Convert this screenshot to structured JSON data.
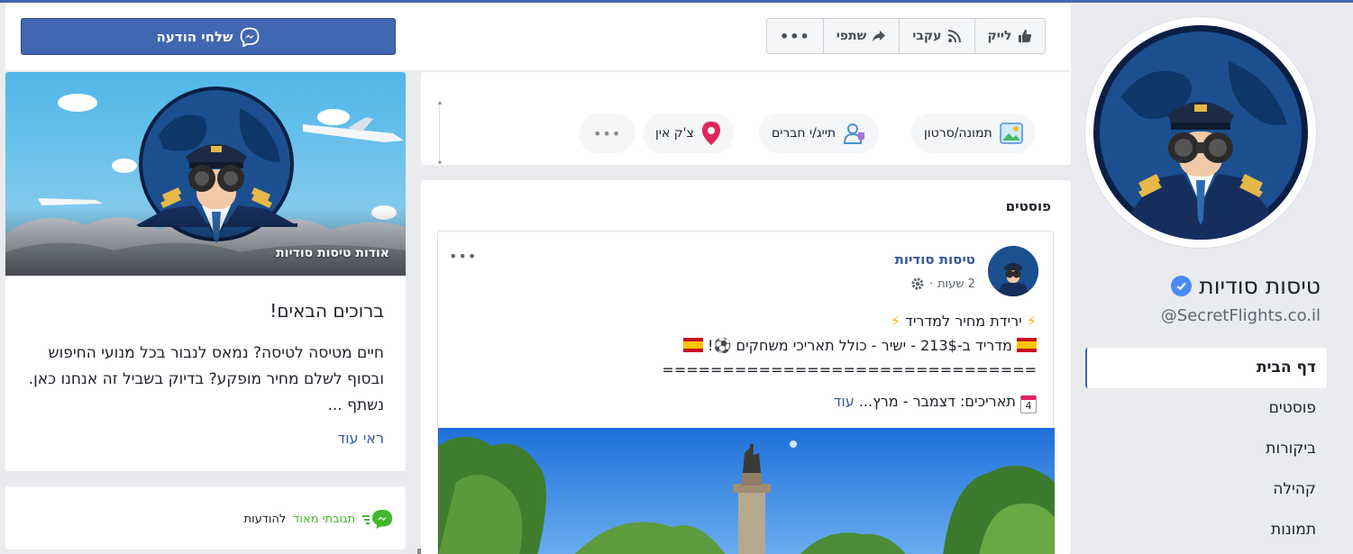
{
  "page": {
    "name": "טיסות סודיות",
    "handle": "@SecretFlights.co.il"
  },
  "nav": {
    "items": [
      {
        "label": "דף הבית"
      },
      {
        "label": "פוסטים"
      },
      {
        "label": "ביקורות"
      },
      {
        "label": "קהילה"
      },
      {
        "label": "תמונות"
      }
    ]
  },
  "actions": {
    "like": "לייק",
    "follow": "עקבי",
    "share": "שתפי",
    "more": "•••"
  },
  "composer": {
    "photo_video": "תמונה/סרטון",
    "tag_friends": "תייג/י חברים",
    "check_in": "צ'ק אין",
    "more": "•••"
  },
  "posts": {
    "title": "פוסטים",
    "post": {
      "author": "טיסות סודיות",
      "time": "2 שעות",
      "sep": "·",
      "line1": "ירידת מחיר למדריד",
      "line2": "מדריד ב-213$ - ישיר - כולל תאריכי משחקים",
      "line2_end": "!",
      "divider": "===============================",
      "line3": "תאריכים: דצמבר - מרץ...",
      "see_more": "עוד",
      "more": "•••",
      "calendar_day": "4"
    }
  },
  "send_message": {
    "label": "שלחי הודעה"
  },
  "about": {
    "caption": "אודות טיסות סודיות",
    "heading": "ברוכים הבאים!",
    "body": "חיים מטיסה לטיסה? נמאס לנבור בכל מנועי החיפוש ובסוף לשלם מחיר מופקע? בדיוק בשביל זה אנחנו כאן. נשתף ...",
    "see_more": "ראי עוד"
  },
  "messaging": {
    "green": "תגובתי מאוד",
    "rest": "להודעות"
  },
  "colors": {
    "brand": "#4267b2",
    "link": "#365899",
    "verified": "#4a8af4"
  }
}
